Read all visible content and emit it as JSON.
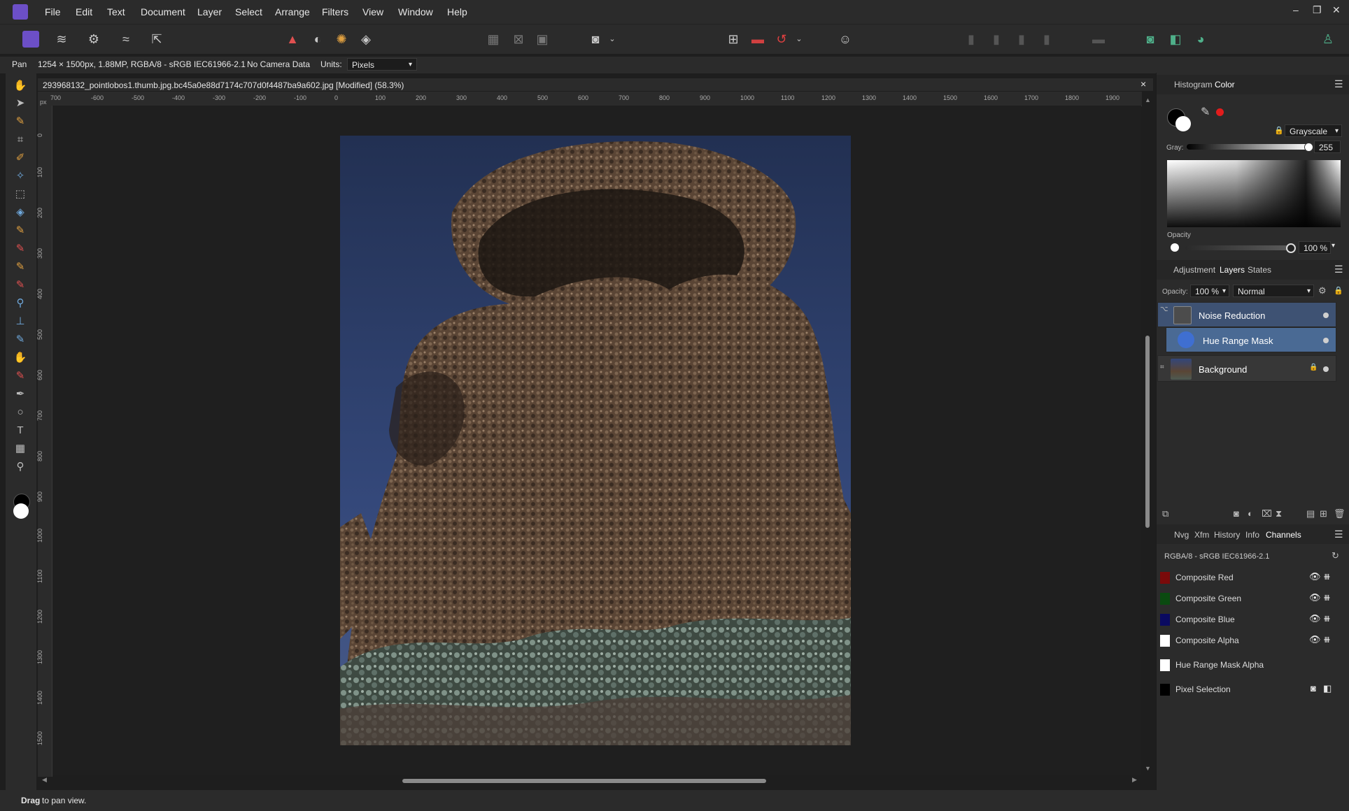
{
  "menubar": {
    "items": [
      "File",
      "Edit",
      "Text",
      "Document",
      "Layer",
      "Select",
      "Arrange",
      "Filters",
      "View",
      "Window",
      "Help"
    ],
    "window_controls": [
      "–",
      "❐",
      "✕"
    ]
  },
  "context": {
    "tool": "Pan",
    "doc_info": "1254 × 1500px, 1.88MP, RGBA/8 - sRGB IEC61966-2.1",
    "camera": "No Camera Data",
    "units_label": "Units:",
    "units_value": "Pixels"
  },
  "document": {
    "title": "293968132_pointlobos1.thumb.jpg.bc45a0e88d7174c707d0f4487ba9a602.jpg [Modified] (58.3%)",
    "close": "×",
    "ruler_unit": "px",
    "h_ticks": [
      "700",
      "-600",
      "-500",
      "-400",
      "-300",
      "-200",
      "-100",
      "0",
      "100",
      "200",
      "300",
      "400",
      "500",
      "600",
      "700",
      "800",
      "900",
      "1000",
      "1100",
      "1200",
      "1300",
      "1400",
      "1500",
      "1600",
      "1700",
      "1800",
      "1900"
    ],
    "v_ticks": [
      "0",
      "100",
      "200",
      "300",
      "400",
      "500",
      "600",
      "700",
      "800",
      "900",
      "1000",
      "1100",
      "1200",
      "1300",
      "1400",
      "1500"
    ]
  },
  "color_panel": {
    "tabs": [
      "Histogram",
      "Color"
    ],
    "active_tab": "Color",
    "mode": "Grayscale",
    "gray_label": "Gray:",
    "gray_value": "255",
    "opacity_label": "Opacity",
    "opacity_value": "100 %"
  },
  "layers_panel": {
    "tabs": [
      "Adjustment",
      "Layers",
      "States"
    ],
    "active_tab": "Layers",
    "opacity_label": "Opacity:",
    "opacity_value": "100 %",
    "blend_mode": "Normal",
    "layers": [
      {
        "name": "Noise Reduction",
        "selected": true
      },
      {
        "name": "Hue Range Mask",
        "selected": true
      },
      {
        "name": "Background",
        "selected": false
      }
    ]
  },
  "channels_panel": {
    "tabs": [
      "Nvg",
      "Xfm",
      "History",
      "Info",
      "Channels"
    ],
    "active_tab": "Channels",
    "profile": "RGBA/8 - sRGB IEC61966-2.1",
    "channels": [
      {
        "name": "Composite Red",
        "color": "#7a0a0a"
      },
      {
        "name": "Composite Green",
        "color": "#0a4a10"
      },
      {
        "name": "Composite Blue",
        "color": "#0a0a60"
      },
      {
        "name": "Composite Alpha",
        "color": "#ffffff"
      },
      {
        "name": "Hue Range Mask Alpha",
        "color": "#ffffff"
      },
      {
        "name": "Pixel Selection",
        "color": "#000000"
      }
    ]
  },
  "status": {
    "bold": "Drag",
    "rest": " to pan view."
  },
  "colors": {
    "accent": "#6c4fc7",
    "selection": "#4a6a94",
    "panel_bg": "#2b2b2b",
    "canvas_bg": "#1f1f1f"
  }
}
